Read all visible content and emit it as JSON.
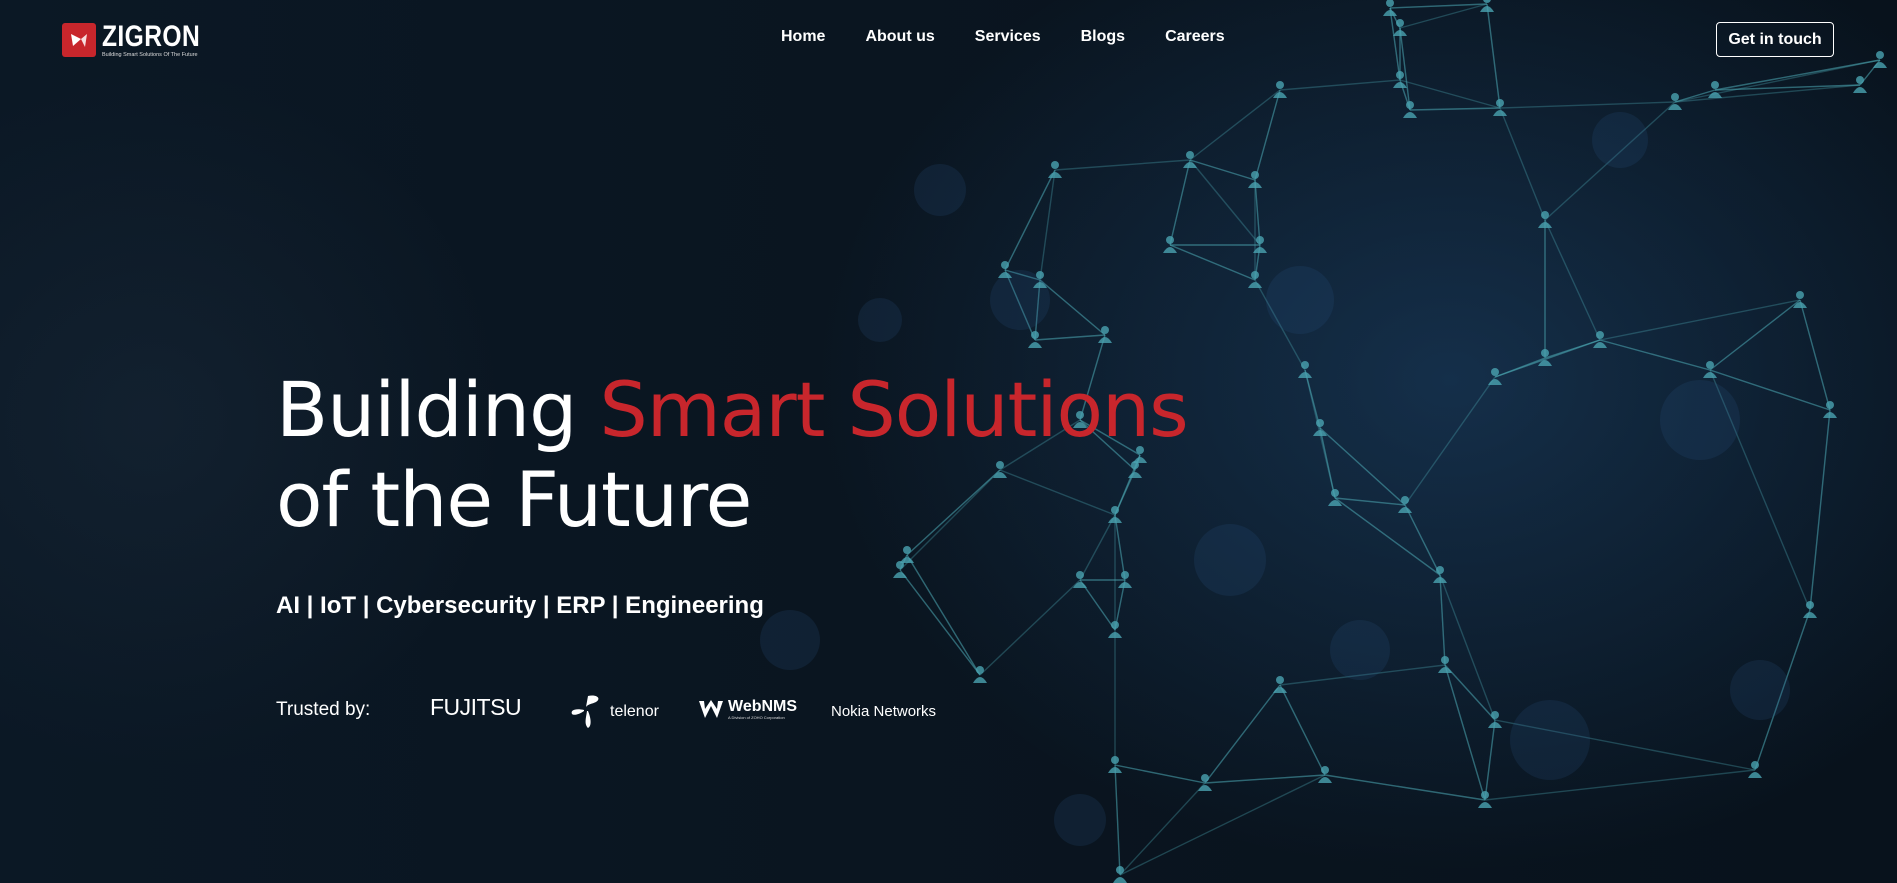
{
  "brand": {
    "name": "ZIGRON",
    "tagline": "Building Smart Solutions Of The Future",
    "accent_color": "#c8262c"
  },
  "nav": {
    "items": [
      {
        "label": "Home"
      },
      {
        "label": "About us"
      },
      {
        "label": "Services"
      },
      {
        "label": "Blogs"
      },
      {
        "label": "Careers"
      }
    ],
    "cta_label": "Get in touch"
  },
  "hero": {
    "title_part1": "Building",
    "title_accent": "Smart Solutions",
    "title_line2": "of the Future",
    "subtitle": "AI | IoT | Cybersecurity | ERP | Engineering"
  },
  "trusted": {
    "label": "Trusted by:",
    "partners": [
      {
        "name": "FUJITSU"
      },
      {
        "name": "telenor"
      },
      {
        "name": "WebNMS",
        "subtext": "A Division of ZOHO Corporation"
      },
      {
        "name": "Nokia Networks"
      }
    ]
  },
  "background": {
    "network_color": "#4aa3b0"
  }
}
